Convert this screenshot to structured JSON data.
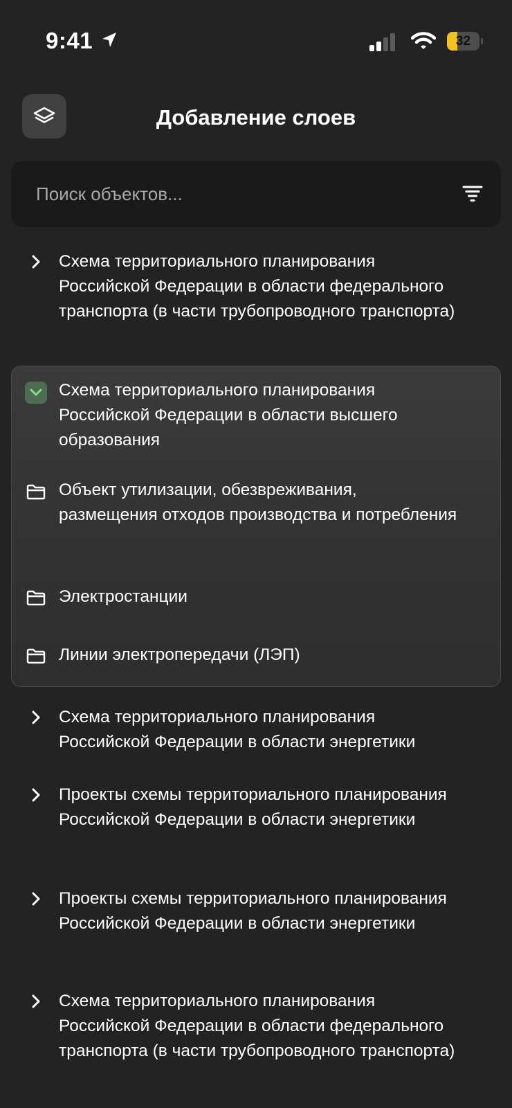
{
  "status_bar": {
    "time": "9:41",
    "battery_level": "32",
    "battery_fraction": 0.32,
    "battery_color": "#f2c21e",
    "icons": [
      "location-arrow-icon",
      "cellular-signal-icon",
      "wifi-icon",
      "battery-icon"
    ]
  },
  "header": {
    "title": "Добавление слоев",
    "layers_icon": "layers-icon"
  },
  "search": {
    "placeholder": "Поиск объектов...",
    "value": "",
    "filter_icon": "filter-icon"
  },
  "list": {
    "items": [
      {
        "label": "Схема территориального планирования Российской Федерации в области федерального транспорта (в части трубопроводного транспорта)",
        "state": "collapsed"
      },
      {
        "label": "Схема территориального планирования Российской Федерации в области высшего образования",
        "state": "expanded",
        "children": [
          {
            "label": "Объект утилизации, обезвреживания, размещения отходов производства и потребления",
            "icon": "folder-icon"
          },
          {
            "label": "Электростанции",
            "icon": "folder-icon"
          },
          {
            "label": "Линии электропередачи (ЛЭП)",
            "icon": "folder-icon"
          }
        ]
      },
      {
        "label": "Схема территориального планирования Российской Федерации в области энергетики",
        "state": "collapsed"
      },
      {
        "label": "Проекты схемы территориального планирования Российской Федерации в области энергетики",
        "state": "collapsed"
      },
      {
        "label": "Проекты схемы территориального планирования Российской Федерации в области энергетики",
        "state": "collapsed"
      },
      {
        "label": "Схема территориального планирования Российской Федерации в области федерального транспорта (в части трубопроводного транспорта)",
        "state": "collapsed"
      }
    ]
  },
  "colors": {
    "background": "#232323",
    "search_background": "#1a1a1a",
    "expanded_background": "#363636",
    "check_background": "#4f6b52",
    "check_mark": "#7ee07e"
  }
}
